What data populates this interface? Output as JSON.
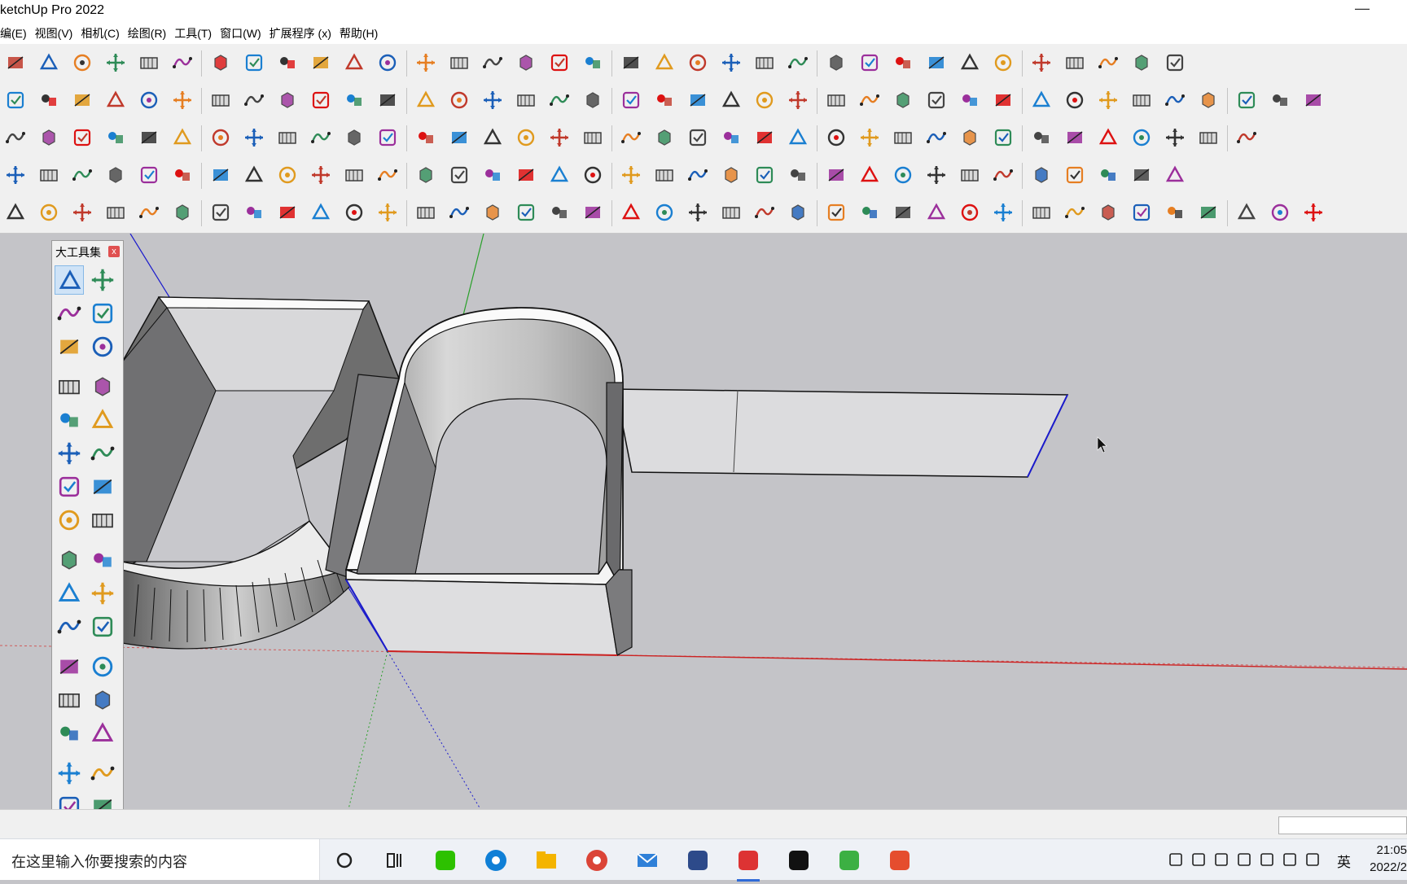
{
  "window": {
    "title": "ketchUp Pro 2022",
    "minimize_glyph": "—"
  },
  "menu": [
    "编(E)",
    "视图(V)",
    "相机(C)",
    "绘图(R)",
    "工具(T)",
    "窗口(W)",
    "扩展程序 (x)",
    "帮助(H)"
  ],
  "palette": {
    "title": "大工具集",
    "close_glyph": "x"
  },
  "toolbar_rows": [
    [
      "select-tool",
      "eraser-tool",
      "line-tool",
      "arc-tool",
      "rectangle-tool",
      "push-pull-tool",
      "follow-me-tool",
      "move-tool",
      "rotate-tool",
      "scale-tool",
      "tape-measure-tool",
      "text-tool",
      "paint-bucket-tool",
      "orbit-tool",
      "pan-tool",
      "zoom-tool",
      "zoom-extents-tool",
      "warehouse-icon",
      "extensions-icon",
      "layers-icon",
      "model-info-icon",
      "account-icon",
      "builder-icon",
      "stairs-icon",
      "iso-view-icon",
      "top-view-icon",
      "front-view-icon",
      "right-view-icon",
      "back-view-icon",
      "left-view-icon",
      "xray-icon",
      "section-plane-icon",
      "section-fill-icon",
      "display-section-icon",
      "section-cuts-icon"
    ],
    [
      "rail-1-icon",
      "rail-2-icon",
      "rail-3-icon",
      "rail-4-icon",
      "rail-5-icon",
      "rail-6-icon",
      "rail-7-icon",
      "rail-8-icon",
      "rail-9-icon",
      "rail-10-icon",
      "rail-11-icon",
      "rail-12-icon",
      "curve-1-icon",
      "curve-2-icon",
      "curve-3-icon",
      "curve-4-icon",
      "curve-5-icon",
      "curve-6-icon",
      "box-icon",
      "slash-1-icon",
      "slash-2-icon",
      "slash-3-icon",
      "slash-4-icon",
      "import-icon",
      "stack-icon",
      "bucket-icon",
      "gears-icon",
      "drop-1-icon",
      "drop-2-icon",
      "pin-1-icon",
      "pin-2-icon",
      "pin-3-icon",
      "lift-icon",
      "arrows-icon",
      "wave-icon",
      "window-icon",
      "tree-1-icon",
      "tree-2-icon",
      "tree-3-icon"
    ],
    [
      "move-axes-icon",
      "refresh-icon",
      "scale-box-icon",
      "help-icon",
      "pencil-line-icon",
      "frame-1-icon",
      "frame-2-icon",
      "frame-3-icon",
      "flag-icon",
      "play-icon",
      "stop-icon",
      "prev-icon",
      "curtain-icon",
      "pin-icon",
      "grid-1-icon",
      "grid-2-icon",
      "grid-3-icon",
      "line-1-icon",
      "line-2-icon",
      "frame-4-icon",
      "triangle-play-icon",
      "dot-icon",
      "dashed-box-icon",
      "close-circle-icon",
      "timer-icon",
      "film-icon",
      "info-icon",
      "blue-1-icon",
      "blue-2-icon",
      "blue-3-icon",
      "cloud-1-icon",
      "cloud-2-icon",
      "cloud-3-icon",
      "expand-icon",
      "nodes-icon",
      "loop-icon",
      "cube-icon"
    ],
    [
      "plank-1-icon",
      "plank-2-icon",
      "plank-3-icon",
      "plank-4-icon",
      "plank-5-icon",
      "tool-1-icon",
      "tool-2-icon",
      "tool-3-icon",
      "tool-4-icon",
      "tool-5-icon",
      "tool-6-icon",
      "tool-7-icon",
      "tool-8-icon",
      "tool-9-icon",
      "tool-10-icon",
      "tool-11-icon",
      "tool-12-icon",
      "tool-13-icon",
      "tool-14-icon",
      "tool-15-icon",
      "tool-16-icon",
      "tool-17-icon",
      "tool-18-icon",
      "su-app-icon",
      "brick-icon",
      "grid-tile-icon",
      "roof-icon",
      "house-icon",
      "lamp-icon",
      "compass-icon",
      "geo-icon",
      "panel-icon",
      "gear-s-icon",
      "stair-2-icon",
      "store-icon"
    ],
    [
      "grid-view-icon",
      "wire-cube-icon",
      "solid-cube-icon",
      "ball-1-icon",
      "ball-2-icon",
      "hand-point-icon",
      "shape-1-icon",
      "palette-icon",
      "teapot-1-icon",
      "teapot-2-icon",
      "teapot-3-icon",
      "teapot-4-icon",
      "bench-icon",
      "frame-a-icon",
      "frame-b-icon",
      "frame-c-icon",
      "frame-d-icon",
      "frame-e-icon",
      "sun-icon",
      "spot-icon",
      "ring-icon",
      "cone-icon",
      "lamp-2-icon",
      "burst-icon",
      "dome-icon",
      "sphere-icon",
      "table-icon",
      "box-open-1-icon",
      "box-open-2-icon",
      "grass-icon",
      "pencil-s-icon",
      "boxes-icon",
      "page-icon",
      "layers-2-icon",
      "eye-icon",
      "block-1-icon",
      "block-2-icon",
      "block-3-icon",
      "block-4-icon"
    ]
  ],
  "taskbar": {
    "search_placeholder": "在这里输入你要搜索的内容",
    "apps": [
      "cortana-icon",
      "task-view-icon",
      "wechat-icon",
      "edge-icon",
      "file-explorer-icon",
      "chrome-icon",
      "mail-icon",
      "cat-icon",
      "sketchup-icon",
      "qq-icon",
      "camtasia-1-icon",
      "camtasia-2-icon"
    ],
    "tray": [
      "chevron-up-icon",
      "mic-icon",
      "screen-icon",
      "people-icon",
      "battery-icon",
      "wifi-icon",
      "volume-icon"
    ],
    "ime": "英",
    "time": "21:05",
    "date": "2022/2"
  }
}
